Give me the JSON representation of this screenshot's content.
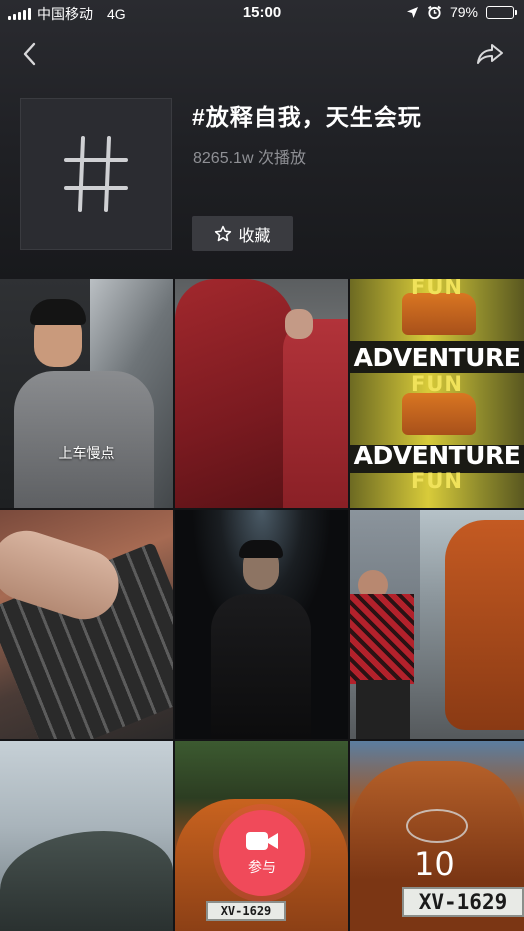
{
  "status_bar": {
    "carrier": "中国移动",
    "network": "4G",
    "time": "15:00",
    "battery": "79%",
    "battery_level": 0.79
  },
  "topic": {
    "title": "#放释自我，天生会玩",
    "plays": "8265.1w 次播放",
    "favorite_label": "收藏",
    "hash_symbol": "#"
  },
  "tiles": [
    {
      "caption": "上车慢点"
    },
    {
      "caption": ""
    },
    {
      "words": [
        "FUN",
        "ADVENTURE",
        "FUN",
        "ADVENTURE",
        "FUN"
      ]
    },
    {
      "caption": ""
    },
    {
      "caption": ""
    },
    {
      "caption": ""
    },
    {
      "caption": ""
    },
    {
      "plate": "XV-1629"
    },
    {
      "plate": "XV-1629",
      "badge": "10"
    }
  ],
  "join_button": {
    "label": "参与"
  },
  "colors": {
    "accent": "#f04a5a",
    "background": "#141416",
    "secondary_text": "#8f9095"
  },
  "icons": {
    "back": "chevron-left-icon",
    "share": "share-arrow-icon",
    "favorite": "star-outline-icon",
    "join": "video-camera-icon",
    "location": "location-arrow-icon",
    "alarm": "alarm-clock-icon"
  }
}
